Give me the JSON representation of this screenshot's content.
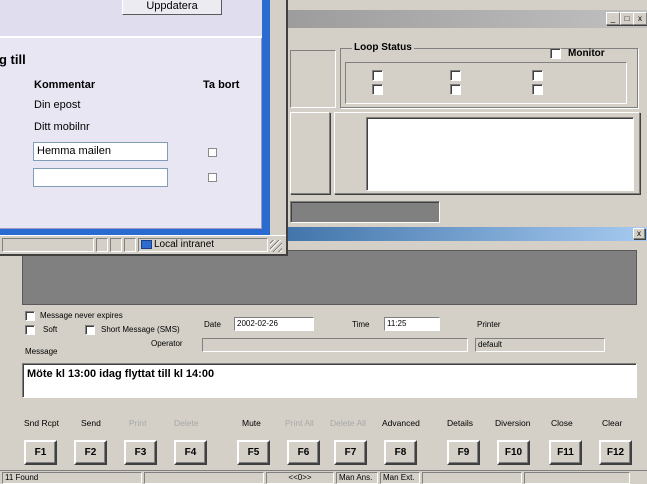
{
  "browser": {
    "update_button": "Uppdatera",
    "section_title": "g till",
    "col_comment": "Kommentar",
    "col_remove": "Ta bort",
    "rows": [
      "Din epost",
      "Ditt mobilnr"
    ],
    "input1_value": "Hemma mailen",
    "input2_value": "",
    "zone": "Local intranet"
  },
  "back_window": {
    "title_buttons": "_|□|x",
    "loop_status_label": "Loop Status",
    "monitor_label": "Monitor"
  },
  "main": {
    "close_glyph": "x",
    "never_expires": "Message never expires",
    "soft": "Soft",
    "short_message": "Short Message (SMS)",
    "operator_label": "Operator",
    "message_label": "Message",
    "date_label": "Date",
    "date_value": "2002-02-26",
    "time_label": "Time",
    "time_value": "11:25",
    "printer_label": "Printer",
    "printer_value": "default",
    "message_text": "Möte kl 13:00 idag flyttat till kl 14:00"
  },
  "fkeys": [
    {
      "label": "Snd Rcpt",
      "key": "F1",
      "disabled": false
    },
    {
      "label": "Send",
      "key": "F2",
      "disabled": false
    },
    {
      "label": "Print",
      "key": "F3",
      "disabled": true
    },
    {
      "label": "Delete",
      "key": "F4",
      "disabled": true
    },
    {
      "label": "Mute",
      "key": "F5",
      "disabled": false
    },
    {
      "label": "Print All",
      "key": "F6",
      "disabled": true
    },
    {
      "label": "Delete All",
      "key": "F7",
      "disabled": true
    },
    {
      "label": "Advanced",
      "key": "F8",
      "disabled": false
    },
    {
      "label": "Details",
      "key": "F9",
      "disabled": false
    },
    {
      "label": "Diversion",
      "key": "F10",
      "disabled": false
    },
    {
      "label": "Close",
      "key": "F11",
      "disabled": false
    },
    {
      "label": "Clear",
      "key": "F12",
      "disabled": false
    }
  ],
  "status": {
    "found": "11 Found",
    "indicator": "<<0>>",
    "man_ans": "Man Ans.",
    "man_ext": "Man Ext."
  }
}
